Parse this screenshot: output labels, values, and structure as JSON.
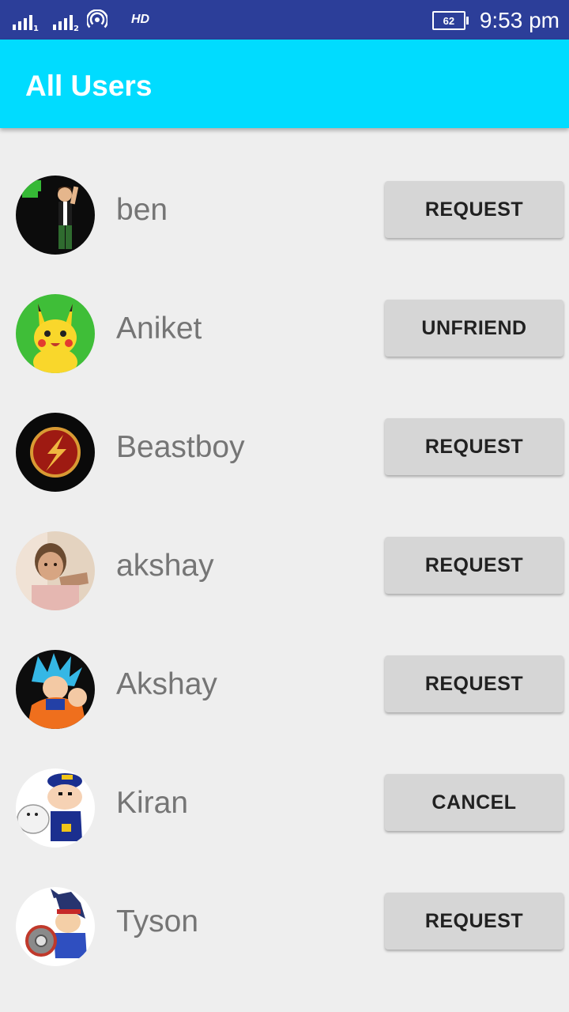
{
  "status_bar": {
    "network_badge": "HD",
    "battery_level": "62",
    "time": "9:53 pm",
    "background_color": "#2c3e99"
  },
  "app_bar": {
    "title": "All Users",
    "background_color": "#00dcff"
  },
  "users": [
    {
      "name": "ben",
      "action": "REQUEST",
      "avatar_icon": "ben10-avatar-icon"
    },
    {
      "name": "Aniket",
      "action": "UNFRIEND",
      "avatar_icon": "pikachu-avatar-icon"
    },
    {
      "name": "Beastboy",
      "action": "REQUEST",
      "avatar_icon": "flash-logo-avatar-icon"
    },
    {
      "name": "akshay",
      "action": "REQUEST",
      "avatar_icon": "child-photo-avatar-icon"
    },
    {
      "name": "Akshay",
      "action": "REQUEST",
      "avatar_icon": "goku-avatar-icon"
    },
    {
      "name": "Kiran",
      "action": "CANCEL",
      "avatar_icon": "shinchan-avatar-icon"
    },
    {
      "name": "Tyson",
      "action": "REQUEST",
      "avatar_icon": "tyson-beyblade-avatar-icon"
    }
  ]
}
